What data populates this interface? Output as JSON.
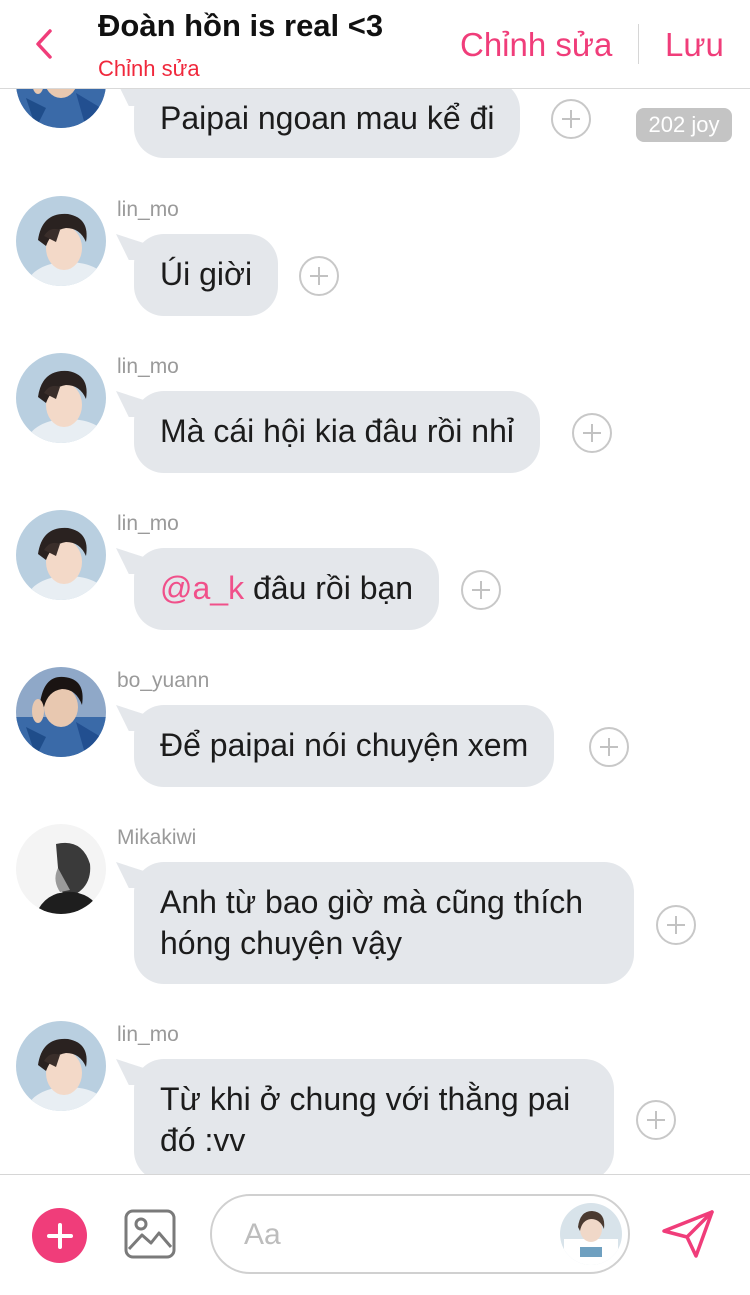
{
  "header": {
    "title": "Đoàn hồn is real <3",
    "subtitle": "Chỉnh sửa",
    "edit_label": "Chỉnh sửa",
    "save_label": "Lưu",
    "accent": "#f03d7a"
  },
  "messages": [
    {
      "sender": "",
      "text": "Paipai ngoan mau kể đi",
      "badge": "202 joy"
    },
    {
      "sender": "lin_mo",
      "text": "Úi giời"
    },
    {
      "sender": "lin_mo",
      "text": "Mà cái hội kia đâu rồi nhỉ"
    },
    {
      "sender": "lin_mo",
      "mention": "@a_k",
      "text": " đâu rồi bạn"
    },
    {
      "sender": "bo_yuann",
      "text": "Để paipai nói chuyện xem"
    },
    {
      "sender": "Mikakiwi",
      "text": "Anh từ bao giờ mà cũng thích hóng chuyện vậy"
    },
    {
      "sender": "lin_mo",
      "text": "Từ khi ở chung với thằng pai đó :vv"
    }
  ],
  "composer": {
    "placeholder": "Aa"
  },
  "icons": {
    "back": "chevron-left-icon",
    "add": "plus-icon",
    "image": "image-icon",
    "react": "add-reaction-icon",
    "send": "send-icon"
  }
}
